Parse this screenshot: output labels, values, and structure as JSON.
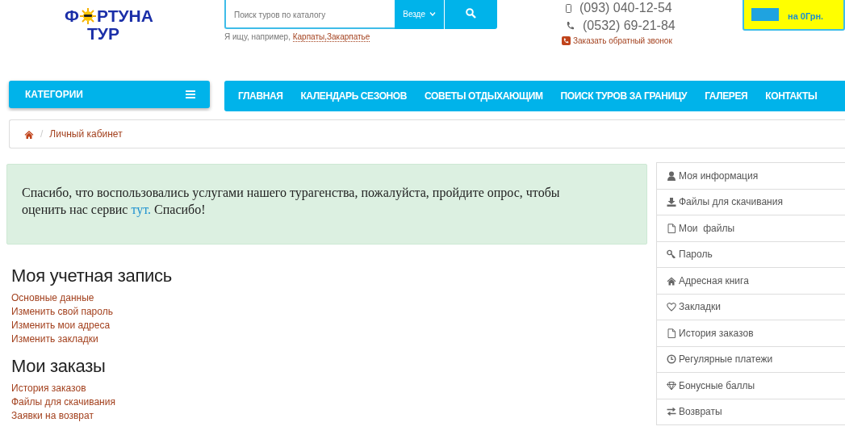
{
  "header": {
    "logo": {
      "line_1_start": "Ф",
      "line_1_end": "РТУНА",
      "line_2": "ТУР"
    },
    "search": {
      "placeholder": "Поиск туров по каталогу",
      "scope": "Везде",
      "hint": "Я ищу, например,",
      "hint_link": "Карпаты,Закарпатье"
    },
    "phones": [
      "(093) 040-12-54",
      "(0532) 69-21-84"
    ],
    "callback": "Заказать обратный звонок",
    "cart": {
      "total": "на 0Грн."
    }
  },
  "nav": {
    "categories": "КАТЕГОРИИ",
    "items": [
      {
        "label": "ГЛАВНАЯ"
      },
      {
        "label": "КАЛЕНДАРЬ СЕЗОНОВ"
      },
      {
        "label": "СОВЕТЫ ОТДЫХАЮЩИМ"
      },
      {
        "label": "ПОИСК ТУРОВ ЗА ГРАНИЦУ"
      },
      {
        "label": "ГАЛЕРЕЯ"
      },
      {
        "label": "КОНТАКТЫ"
      }
    ]
  },
  "breadcrumb": {
    "separator": "/",
    "items": [
      "Личный кабинет"
    ]
  },
  "alert": {
    "text": "Спасибо, что воспользовались услугами нашего турагенства, пожалуйста, пройдите опрос, чтобы оценить нас сервис",
    "link": "тут.",
    "text_after": "Спасибо!"
  },
  "sections": [
    {
      "title": "Моя учетная запись",
      "links": [
        "Основные данные",
        "Изменить свой пароль",
        "Изменить мои адреса",
        "Изменить закладки"
      ]
    },
    {
      "title": "Мои заказы",
      "links": [
        "История заказов",
        "Файлы для скачивания",
        "Заявки на возврат"
      ]
    }
  ],
  "sidebar": {
    "items": [
      {
        "label": "Моя информация",
        "kind": "user"
      },
      {
        "label": "Файлы для скачивания",
        "kind": "download"
      },
      {
        "label": "Мои  файлы",
        "kind": "file"
      },
      {
        "label": "Пароль",
        "kind": "key"
      },
      {
        "label": "Адресная книга",
        "kind": "home"
      },
      {
        "label": "Закладки",
        "kind": "heart"
      },
      {
        "label": "История заказов",
        "kind": "file"
      },
      {
        "label": "Регулярные платежи",
        "kind": "clock"
      },
      {
        "label": "Бонусные баллы",
        "kind": "diamond"
      },
      {
        "label": "Возвраты",
        "kind": "exchange"
      }
    ]
  }
}
